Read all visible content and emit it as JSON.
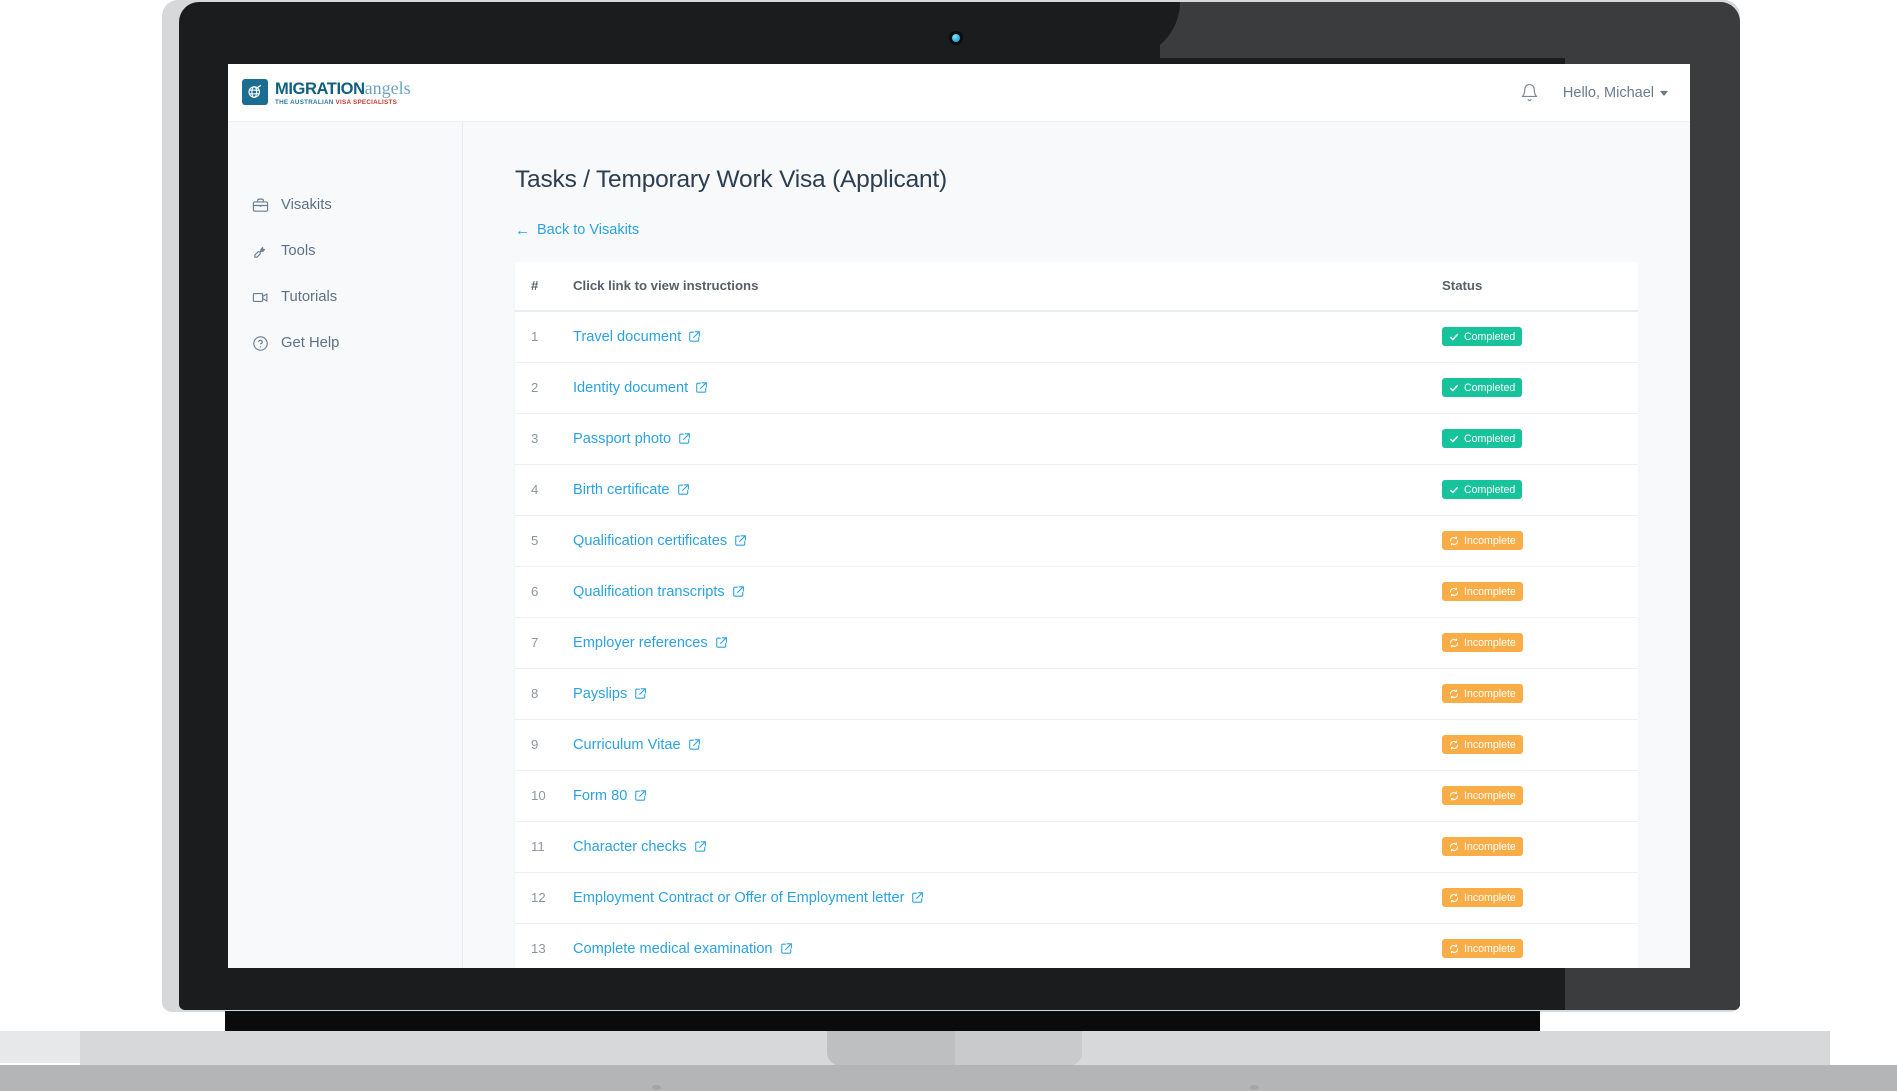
{
  "brand": {
    "name_bold": "MIGRATION",
    "name_light": "angels",
    "tagline_a": "THE AUSTRALIAN ",
    "tagline_b": "VISA SPECIALISTS",
    "mark_icon": "globe-passport-icon",
    "color_dark": "#0f5f80",
    "color_light": "#6ba3bd"
  },
  "topbar": {
    "bell_icon": "notification-bell-icon",
    "greeting": "Hello, Michael",
    "caret_icon": "chevron-down-icon"
  },
  "sidebar": {
    "items": [
      {
        "label": "Visakits",
        "icon": "briefcase-icon"
      },
      {
        "label": "Tools",
        "icon": "wrench-icon"
      },
      {
        "label": "Tutorials",
        "icon": "video-camera-icon"
      },
      {
        "label": "Get Help",
        "icon": "question-circle-icon"
      }
    ]
  },
  "main": {
    "page_title": "Tasks / Temporary Work Visa (Applicant)",
    "back_link": "Back to Visakits",
    "back_arrow_icon": "arrow-left-icon",
    "table": {
      "headers": {
        "num": "#",
        "name": "Click link to view instructions",
        "status": "Status"
      },
      "link_icon": "external-link-icon",
      "status_labels": {
        "completed": "Completed",
        "incomplete": "Incomplete"
      },
      "status_icons": {
        "completed": "check-icon",
        "incomplete": "sync-refresh-icon"
      },
      "status_colors": {
        "completed": "#17c39a",
        "incomplete": "#f9ad47"
      },
      "rows": [
        {
          "num": "1",
          "name": "Travel document",
          "status": "completed"
        },
        {
          "num": "2",
          "name": "Identity document",
          "status": "completed"
        },
        {
          "num": "3",
          "name": "Passport photo",
          "status": "completed"
        },
        {
          "num": "4",
          "name": "Birth certificate",
          "status": "completed"
        },
        {
          "num": "5",
          "name": "Qualification certificates",
          "status": "incomplete"
        },
        {
          "num": "6",
          "name": "Qualification transcripts",
          "status": "incomplete"
        },
        {
          "num": "7",
          "name": "Employer references",
          "status": "incomplete"
        },
        {
          "num": "8",
          "name": "Payslips",
          "status": "incomplete"
        },
        {
          "num": "9",
          "name": "Curriculum Vitae",
          "status": "incomplete"
        },
        {
          "num": "10",
          "name": "Form 80",
          "status": "incomplete"
        },
        {
          "num": "11",
          "name": "Character checks",
          "status": "incomplete"
        },
        {
          "num": "12",
          "name": "Employment Contract or Offer of Employment letter",
          "status": "incomplete"
        },
        {
          "num": "13",
          "name": "Complete medical examination",
          "status": "incomplete"
        }
      ]
    }
  }
}
